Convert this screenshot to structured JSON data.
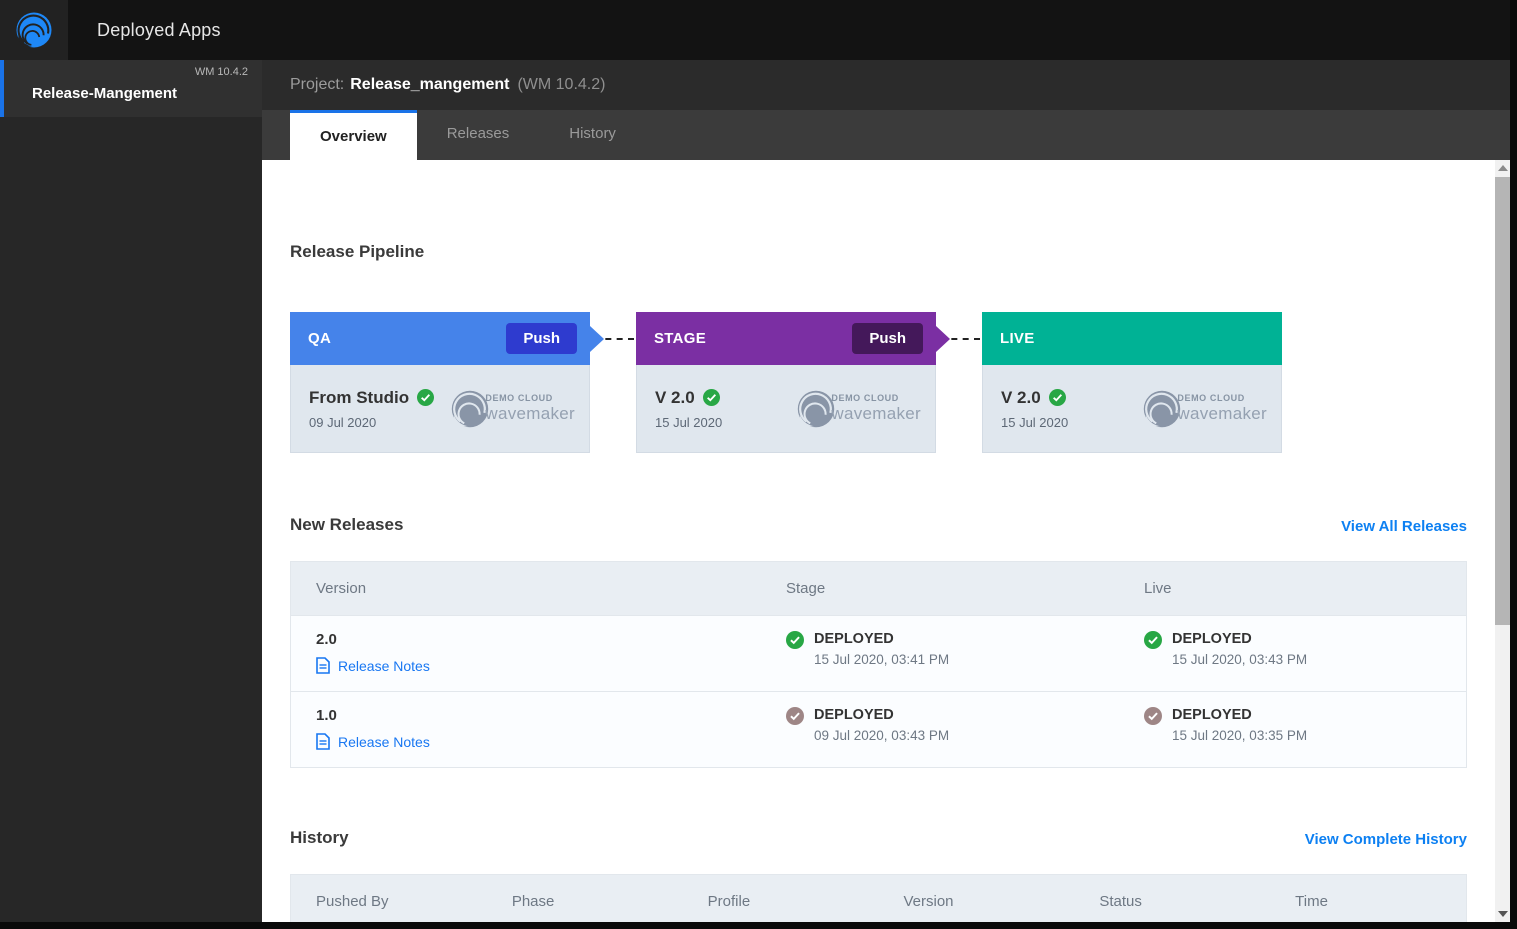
{
  "topbar": {
    "title": "Deployed Apps"
  },
  "sidebar": {
    "item": {
      "name": "Release-Mangement",
      "badge": "WM 10.4.2"
    }
  },
  "header": {
    "label": "Project:",
    "project_name": "Release_mangement",
    "version": "(WM 10.4.2)"
  },
  "tabs": [
    {
      "label": "Overview",
      "active": true
    },
    {
      "label": "Releases",
      "active": false
    },
    {
      "label": "History",
      "active": false
    }
  ],
  "pipeline": {
    "heading": "Release Pipeline",
    "stages": [
      {
        "name": "QA",
        "push_label": "Push",
        "version": "From Studio",
        "date": "09 Jul 2020"
      },
      {
        "name": "STAGE",
        "push_label": "Push",
        "version": "V 2.0",
        "date": "15 Jul 2020"
      },
      {
        "name": "LIVE",
        "version": "V 2.0",
        "date": "15 Jul 2020"
      }
    ],
    "cloud_logo": {
      "line1": "DEMO CLOUD",
      "line2": "wavemaker"
    }
  },
  "new_releases": {
    "heading": "New Releases",
    "view_all": "View All Releases",
    "columns": [
      "Version",
      "Stage",
      "Live"
    ],
    "release_notes_label": "Release Notes",
    "rows": [
      {
        "version": "2.0",
        "stage": {
          "status": "DEPLOYED",
          "time": "15 Jul 2020, 03:41 PM",
          "check": "green"
        },
        "live": {
          "status": "DEPLOYED",
          "time": "15 Jul 2020, 03:43 PM",
          "check": "green"
        }
      },
      {
        "version": "1.0",
        "stage": {
          "status": "DEPLOYED",
          "time": "09 Jul 2020, 03:43 PM",
          "check": "muted"
        },
        "live": {
          "status": "DEPLOYED",
          "time": "15 Jul 2020, 03:35 PM",
          "check": "muted"
        }
      }
    ]
  },
  "history": {
    "heading": "History",
    "view_all": "View Complete History",
    "columns": [
      "Pushed By",
      "Phase",
      "Profile",
      "Version",
      "Status",
      "Time"
    ]
  },
  "colors": {
    "accent_blue": "#1a73e8",
    "qa_header": "#4583ea",
    "qa_push": "#2e3bcf",
    "stage_header": "#7b2fa3",
    "stage_push": "#44185a",
    "live_header": "#00b295",
    "link_blue": "#0d80f2",
    "check_green": "#28a745",
    "check_muted": "#9e8686"
  }
}
